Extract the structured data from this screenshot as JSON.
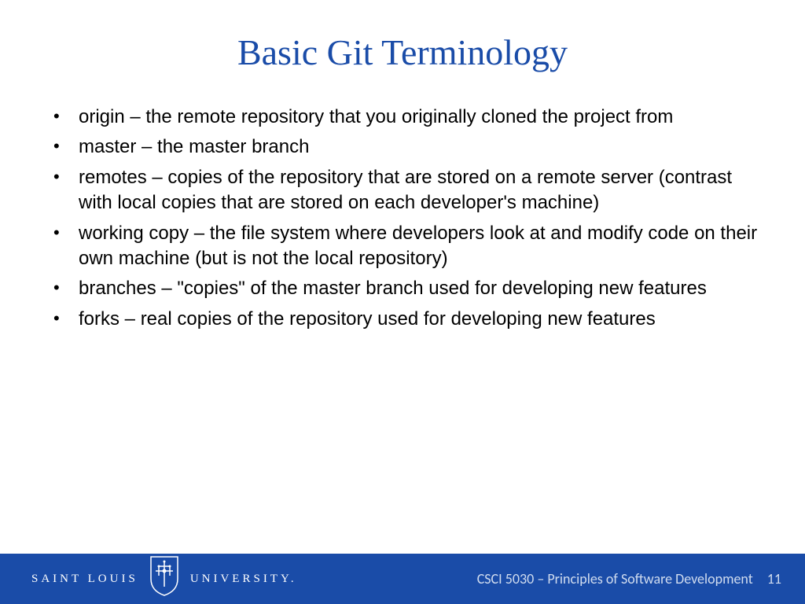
{
  "title": "Basic Git Terminology",
  "bullets": [
    "origin – the remote repository that you originally cloned the project from",
    "master – the master branch",
    "remotes – copies of the repository that are stored on a remote server (contrast with local copies that are stored on each developer's machine)",
    "working copy – the file system where developers look at and modify code on their own machine (but is not the local repository)",
    "branches – \"copies\" of the master branch used for developing new features",
    "forks – real copies of the repository used for developing new features"
  ],
  "footer": {
    "logo_left": "SAINT LOUIS",
    "logo_right": "UNIVERSITY.",
    "course": "CSCI 5030 – Principles of Software Development",
    "page": "11"
  }
}
